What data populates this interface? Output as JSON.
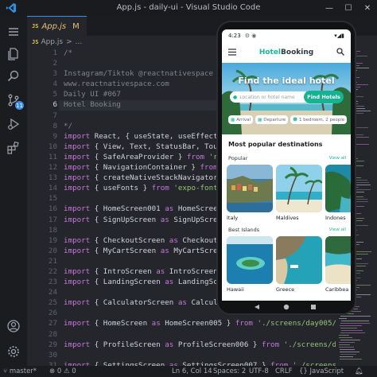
{
  "window": {
    "title": "App.js - daily-ui - Visual Studio Code"
  },
  "tabs": [
    {
      "label": "App.js",
      "modified": "M",
      "badge": "JS"
    }
  ],
  "breadcrumb": {
    "badge": "JS",
    "file": "App.js",
    "separator": ">",
    "more": "..."
  },
  "activity": {
    "source_control_badge": "11"
  },
  "editor": {
    "line_numbers": [
      "1",
      "2",
      "3",
      "4",
      "5",
      "6",
      "7",
      "8",
      "9",
      "10",
      "11",
      "12",
      "13",
      "14",
      "15",
      "16",
      "17",
      "18",
      "19",
      "20",
      "21",
      "22",
      "23",
      "24",
      "25",
      "26",
      "27",
      "28",
      "29",
      "30",
      "31"
    ],
    "current_line_index": 5,
    "lines": [
      [
        [
          "c",
          "/*"
        ]
      ],
      [
        [
          "c",
          ""
        ]
      ],
      [
        [
          "c",
          "Instagram/Tiktok @reactnativespace"
        ]
      ],
      [
        [
          "c",
          "www.reactnativespace.com"
        ]
      ],
      [
        [
          "c",
          "Daily UI #067"
        ]
      ],
      [
        [
          "c",
          "Hotel Booking"
        ]
      ],
      [
        [
          "c",
          ""
        ]
      ],
      [
        [
          "c",
          "*/"
        ]
      ],
      [
        [
          "k",
          "import"
        ],
        [
          "p",
          " React, { useState, useEffect }"
        ]
      ],
      [
        [
          "k",
          "import"
        ],
        [
          "p",
          " { View, Text, StatusBar, Touch"
        ]
      ],
      [
        [
          "k",
          "import"
        ],
        [
          "p",
          " { SafeAreaProvider } "
        ],
        [
          "k",
          "from"
        ],
        [
          "s",
          " 'rea"
        ]
      ],
      [
        [
          "k",
          "import"
        ],
        [
          "p",
          " { NavigationContainer } "
        ],
        [
          "k",
          "from"
        ]
      ],
      [
        [
          "k",
          "import"
        ],
        [
          "p",
          " { createNativeStackNavigator }"
        ]
      ],
      [
        [
          "k",
          "import"
        ],
        [
          "p",
          " { useFonts } "
        ],
        [
          "k",
          "from"
        ],
        [
          "s",
          " 'expo-font'"
        ],
        [
          "p",
          ";"
        ]
      ],
      [
        [
          "p",
          ""
        ]
      ],
      [
        [
          "k",
          "import"
        ],
        [
          "p",
          " { HomeScreen001 "
        ],
        [
          "k",
          "as"
        ],
        [
          "p",
          " HomeScreen001"
        ]
      ],
      [
        [
          "k",
          "import"
        ],
        [
          "p",
          " { SignUpScreen "
        ],
        [
          "k",
          "as"
        ],
        [
          "p",
          " SignUpScreen"
        ]
      ],
      [
        [
          "p",
          ""
        ]
      ],
      [
        [
          "k",
          "import"
        ],
        [
          "p",
          " { CheckoutScreen "
        ],
        [
          "k",
          "as"
        ],
        [
          "p",
          " CheckoutScreen"
        ]
      ],
      [
        [
          "k",
          "import"
        ],
        [
          "p",
          " { MyCartScreen "
        ],
        [
          "k",
          "as"
        ],
        [
          "p",
          " MyCartScreen"
        ]
      ],
      [
        [
          "p",
          ""
        ]
      ],
      [
        [
          "k",
          "import"
        ],
        [
          "p",
          " { IntroScreen "
        ],
        [
          "k",
          "as"
        ],
        [
          "p",
          " IntroScreen00"
        ]
      ],
      [
        [
          "k",
          "import"
        ],
        [
          "p",
          " { LandingScreen "
        ],
        [
          "k",
          "as"
        ],
        [
          "p",
          " LandingScreen"
        ]
      ],
      [
        [
          "p",
          ""
        ]
      ],
      [
        [
          "k",
          "import"
        ],
        [
          "p",
          " { CalculatorScreen "
        ],
        [
          "k",
          "as"
        ],
        [
          "p",
          " Calculato"
        ]
      ],
      [
        [
          "p",
          ""
        ]
      ],
      [
        [
          "k",
          "import"
        ],
        [
          "p",
          " { HomeScreen "
        ],
        [
          "k",
          "as"
        ],
        [
          "p",
          " HomeScreen005 } "
        ],
        [
          "k",
          "from"
        ],
        [
          "s",
          " './screens/day005/Ho"
        ]
      ],
      [
        [
          "p",
          ""
        ]
      ],
      [
        [
          "k",
          "import"
        ],
        [
          "p",
          " { ProfileScreen "
        ],
        [
          "k",
          "as"
        ],
        [
          "p",
          " ProfileScreen006 } "
        ],
        [
          "k",
          "from"
        ],
        [
          "s",
          " './screens/da"
        ]
      ],
      [
        [
          "p",
          ""
        ]
      ],
      [
        [
          "k",
          "import"
        ],
        [
          "p",
          " { SettingsScreen "
        ],
        [
          "k",
          "as"
        ],
        [
          "p",
          " SettingsScreen007 } "
        ],
        [
          "k",
          "from"
        ],
        [
          "s",
          " './screens/"
        ]
      ]
    ]
  },
  "statusbar": {
    "branch": "master*",
    "errors": "0",
    "warnings": "0",
    "position": "Ln 6, Col 14",
    "spaces": "Spaces: 2",
    "encoding": "UTF-8",
    "eol": "CRLF",
    "language": "JavaScript"
  },
  "phone": {
    "time": "4:23",
    "brand_part1": "Hotel",
    "brand_part2": "Booking",
    "hero_title": "Find the ideal hotel",
    "search_placeholder": "Location or hotel name",
    "find_button": "Find Hotels",
    "filter_arrival": "Arrival",
    "filter_departure": "Departure",
    "filter_guests": "1 bedroom, 2 people",
    "popular_title": "Most popular destinations",
    "popular_sub": "Popular",
    "best_sub": "Best Islands",
    "view_all": "View all",
    "popular_cards": [
      "Italy",
      "Maldives",
      "Indones"
    ],
    "island_cards": [
      "Hawaii",
      "Greece",
      "Caribbea"
    ]
  },
  "colors": {
    "accent": "#19b89b",
    "editor_bg": "#24262b",
    "keyword": "#c678dd",
    "string": "#98c379",
    "comment": "#7f848e"
  }
}
